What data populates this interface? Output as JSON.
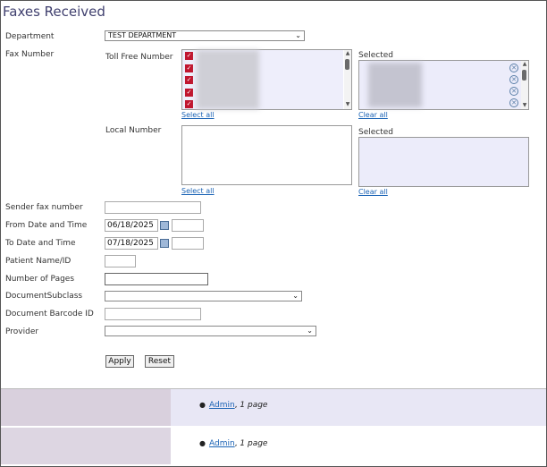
{
  "page": {
    "title": "Faxes Received"
  },
  "form": {
    "department": {
      "label": "Department",
      "value": "TEST DEPARTMENT"
    },
    "fax_number": {
      "label": "Fax Number",
      "toll_free": {
        "label": "Toll Free Number",
        "select_all": "Select all",
        "selected_label": "Selected",
        "clear_all": "Clear all"
      },
      "local": {
        "label": "Local Number",
        "select_all": "Select all",
        "selected_label": "Selected",
        "clear_all": "Clear all"
      }
    },
    "sender_fax": {
      "label": "Sender fax number",
      "value": ""
    },
    "from_date": {
      "label": "From Date and Time",
      "date": "06/18/2025",
      "time": ""
    },
    "to_date": {
      "label": "To Date and Time",
      "date": "07/18/2025",
      "time": ""
    },
    "patient": {
      "label": "Patient Name/ID",
      "value": ""
    },
    "pages": {
      "label": "Number of Pages",
      "value": ""
    },
    "subclass": {
      "label": "DocumentSubclass",
      "value": ""
    },
    "barcode": {
      "label": "Document Barcode ID",
      "value": ""
    },
    "provider": {
      "label": "Provider",
      "value": ""
    },
    "apply_label": "Apply",
    "reset_label": "Reset"
  },
  "results": [
    {
      "user": "Admin",
      "pages": "1 page"
    },
    {
      "user": "Admin",
      "pages": "1 page"
    }
  ],
  "colors": {
    "title": "#3f3f6e",
    "link": "#1b63b5",
    "checkbox": "#c0152f",
    "selected_bg": "#ececfa",
    "row_alt_bg": "#e8e7f5"
  },
  "icons": {
    "checkbox": "checkmark",
    "remove": "circle-x",
    "calendar": "calendar",
    "dropdown": "chevron-down"
  }
}
